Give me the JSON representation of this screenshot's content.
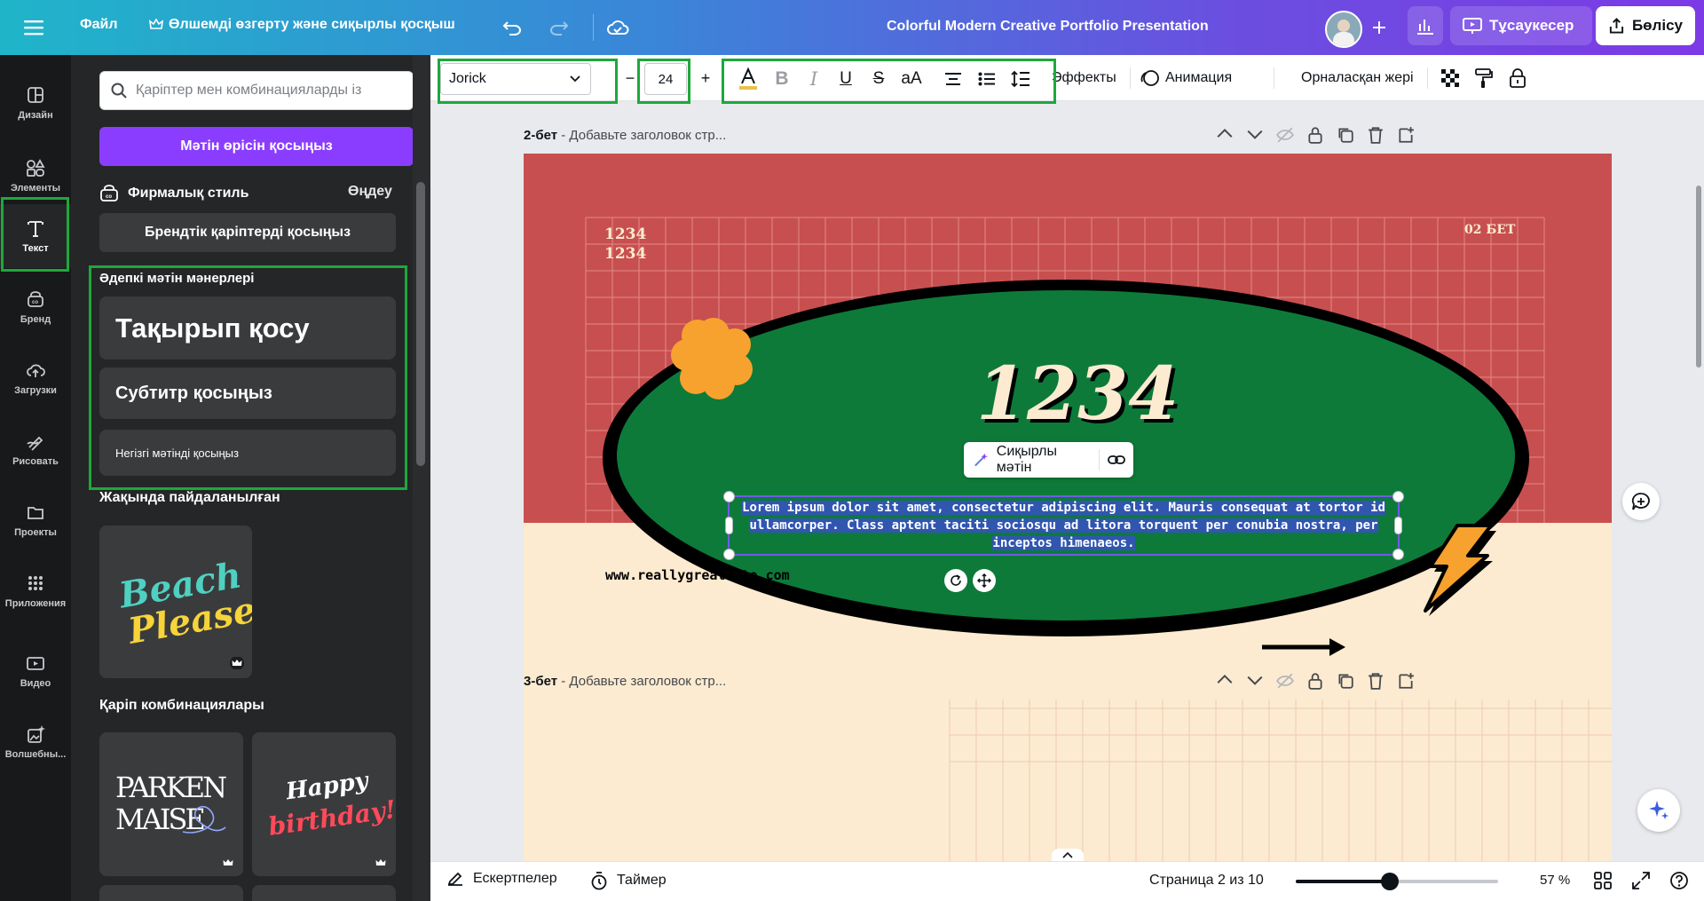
{
  "topbar": {
    "menu_icon": "hamburger-icon",
    "file_label": "Файл",
    "resize_label": "Өлшемді өзгерту және сиқырлы қосқыш",
    "doc_title": "Colorful Modern Creative Portfolio Presentation",
    "present_label": "Тұсаукесер",
    "share_label": "Бөлісу",
    "gradient": [
      "#1fb5c9",
      "#7c3ae6"
    ]
  },
  "rail": [
    {
      "label": "Дизайн",
      "icon": "design-icon"
    },
    {
      "label": "Элементы",
      "icon": "elements-icon"
    },
    {
      "label": "Текст",
      "icon": "text-icon"
    },
    {
      "label": "Бренд",
      "icon": "brand-icon"
    },
    {
      "label": "Загрузки",
      "icon": "upload-cloud-icon"
    },
    {
      "label": "Рисовать",
      "icon": "draw-icon"
    },
    {
      "label": "Проекты",
      "icon": "folder-icon"
    },
    {
      "label": "Приложения",
      "icon": "apps-grid-icon"
    },
    {
      "label": "Видео",
      "icon": "video-icon"
    },
    {
      "label": "Волшебны...",
      "icon": "magic-media-icon"
    }
  ],
  "panel": {
    "search_placeholder": "Қаріптер мен комбинацияларды із",
    "add_textbox": "Мәтін өрісін қосыңыз",
    "brand_style_title": "Фирмалық стиль",
    "brand_style_edit": "Өңдеу",
    "add_brand_fonts": "Брендтік қаріптерді қосыңыз",
    "default_styles_title": "Әдепкі мәтін мәнерлері",
    "heading": "Тақырып қосу",
    "subheading": "Субтитр қосыңыз",
    "body": "Негізгі мәтінді қосыңыз",
    "recent_title": "Жақында пайдаланылған",
    "recent_item": "Beach Please",
    "combos_title": "Қаріп комбинациялары",
    "combo1_line1": "PARKEN",
    "combo1_line2": "MAISE",
    "combo2_line1": "Happy",
    "combo2_line2": "birthday!"
  },
  "toolbar": {
    "font": "Jorick",
    "size": "24",
    "effects": "Эффекты",
    "animation": "Анимация",
    "position": "Орналасқан жері"
  },
  "page2": {
    "label": "2-бет",
    "title_placeholder": "- Добавьте заголовок стр...",
    "tl_text_1": "1234",
    "tl_text_2": "1234",
    "tr_text": "02 БЕТ",
    "big_number": "1234",
    "magic_text": "Сиқырлы мәтін",
    "body_text": "Lorem ipsum dolor sit amet, consectetur adipiscing elit. Mauris consequat at tortor id ullamcorper. Class aptent taciti sociosqu ad litora torquent per conubia nostra, per inceptos himenaeos.",
    "website": "www.reallygreatsite.com",
    "colors": {
      "red": "#c84f4f",
      "cream": "#fcebd0",
      "green": "#0d7a3a",
      "black": "#000000",
      "orange": "#f7a22e"
    }
  },
  "page3": {
    "label": "3-бет",
    "title_placeholder": "- Добавьте заголовок стр..."
  },
  "bottombar": {
    "notes": "Ескертпелер",
    "timer": "Таймер",
    "page_indicator": "Страница 2 из 10",
    "zoom": "57 %",
    "zoom_level": 0.57
  }
}
